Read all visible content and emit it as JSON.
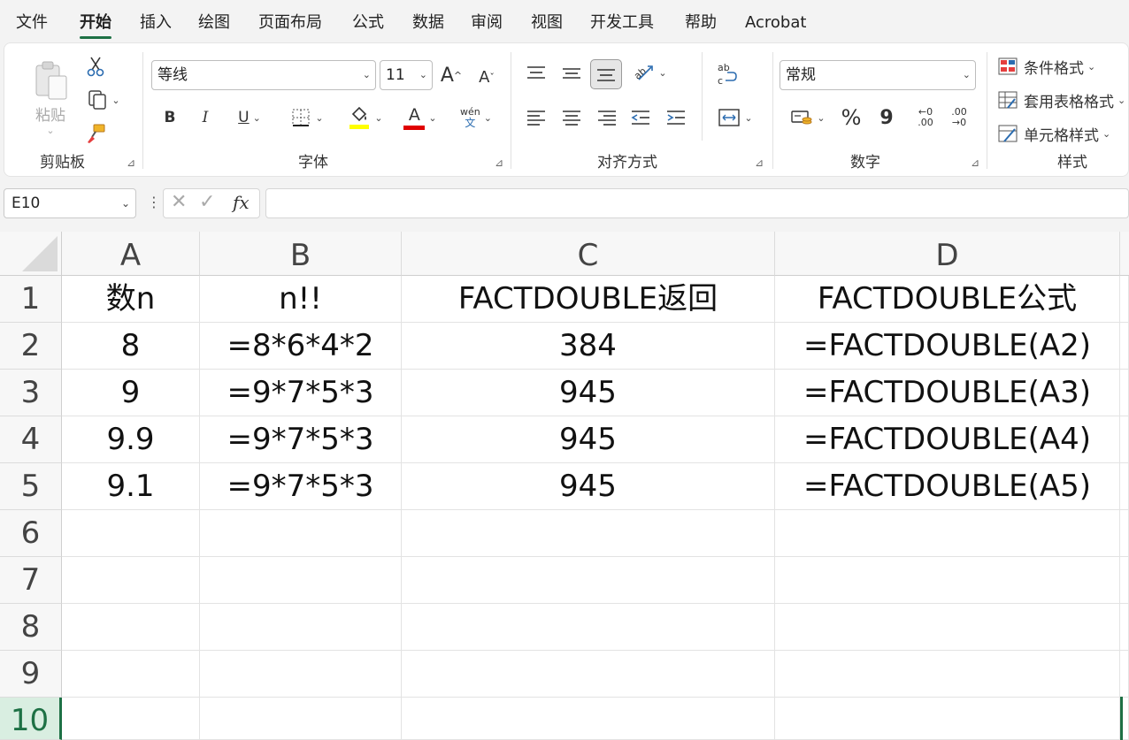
{
  "menu": [
    "文件",
    "开始",
    "插入",
    "绘图",
    "页面布局",
    "公式",
    "数据",
    "审阅",
    "视图",
    "开发工具",
    "帮助",
    "Acrobat"
  ],
  "ribbon": {
    "clipboard": {
      "paste_label": "粘贴",
      "group_label": "剪贴板"
    },
    "font": {
      "font_name": "等线",
      "font_size": "11",
      "grow": "A",
      "shrink": "A",
      "bold": "B",
      "italic": "I",
      "underline": "U",
      "font_color_letter": "A",
      "phonetic_top": "wén",
      "phonetic_bottom": "文",
      "group_label": "字体",
      "fill_color": "#ffff00",
      "font_color": "#e00000"
    },
    "alignment": {
      "group_label": "对齐方式"
    },
    "number": {
      "format": "常规",
      "percent": "%",
      "comma": "9",
      "inc_decimal_top": "←0",
      "inc_decimal_bottom": ".00",
      "dec_decimal_top": ".00",
      "dec_decimal_bottom": "→0",
      "group_label": "数字"
    },
    "styles": {
      "conditional": "条件格式",
      "table_format": "套用表格格式",
      "cell_styles": "单元格样式",
      "group_label": "样式"
    }
  },
  "formula_bar": {
    "name_box": "E10",
    "fx": "fx",
    "value": ""
  },
  "grid": {
    "columns": [
      "A",
      "B",
      "C",
      "D"
    ],
    "rows": [
      "1",
      "2",
      "3",
      "4",
      "5",
      "6",
      "7",
      "8",
      "9",
      "10"
    ],
    "cells": [
      [
        "数n",
        "n!!",
        "FACTDOUBLE返回",
        "FACTDOUBLE公式"
      ],
      [
        "8",
        "=8*6*4*2",
        "384",
        "=FACTDOUBLE(A2)"
      ],
      [
        "9",
        "=9*7*5*3",
        "945",
        "=FACTDOUBLE(A3)"
      ],
      [
        "9.9",
        "=9*7*5*3",
        "945",
        "=FACTDOUBLE(A4)"
      ],
      [
        "9.1",
        "=9*7*5*3",
        "945",
        "=FACTDOUBLE(A5)"
      ],
      [
        "",
        "",
        "",
        ""
      ],
      [
        "",
        "",
        "",
        ""
      ],
      [
        "",
        "",
        "",
        ""
      ],
      [
        "",
        "",
        "",
        ""
      ],
      [
        "",
        "",
        "",
        ""
      ]
    ],
    "selected_row": "10",
    "accent": "#1e7145"
  }
}
